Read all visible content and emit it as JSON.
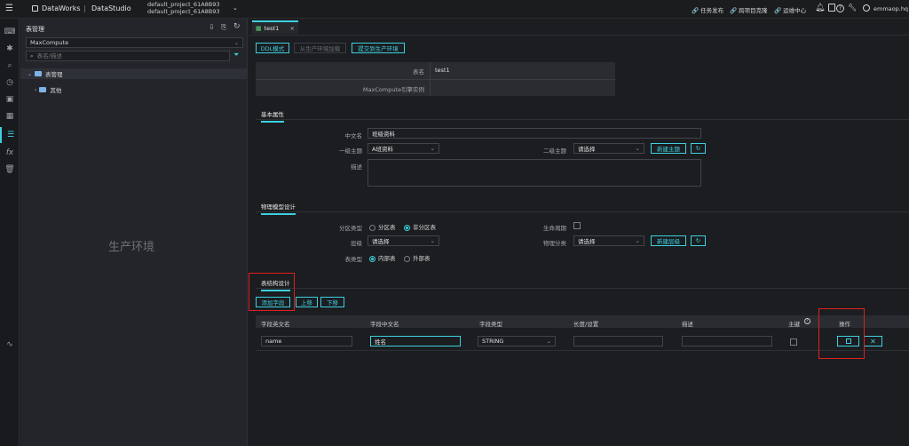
{
  "topbar": {
    "brand": "DataWorks",
    "product": "DataStudio",
    "project_line1": "default_project_61A8B93",
    "project_line2": "default_project_61A8B93",
    "links": [
      "任务发布",
      "跨项目克隆",
      "运维中心"
    ],
    "user": "emmaop.hq"
  },
  "sidepanel": {
    "title": "表管理",
    "engine": "MaxCompute",
    "search_placeholder": "表名/描述",
    "tree": [
      {
        "label": "表管理",
        "expanded": true
      },
      {
        "label": "其他",
        "expanded": false
      }
    ],
    "env_label": "生产环境"
  },
  "tab": {
    "label": "test1"
  },
  "toolbar": {
    "ddl_label": "DDL模式",
    "load_label": "从生产环境加载",
    "submit_label": "提交到生产环境"
  },
  "info": {
    "rows": [
      {
        "label": "表名",
        "value": "test1"
      },
      {
        "label": "MaxCompute引擎实例",
        "value": ""
      }
    ]
  },
  "basic": {
    "section": "基本属性",
    "cn_name_label": "中文名",
    "cn_name_value": "班级资料",
    "topic1_label": "一级主题",
    "topic1_value": "A班资料",
    "topic2_label": "二级主题",
    "topic2_value": "请选择",
    "new_topic_label": "新建主题",
    "desc_label": "描述"
  },
  "physical": {
    "section": "物理模型设计",
    "partition_label": "分区类型",
    "partition_opt1": "分区表",
    "partition_opt2": "非分区表",
    "lifecycle_label": "生命周期",
    "level_label": "层级",
    "level_value": "请选择",
    "physical_class_label": "物理分类",
    "physical_class_value": "请选择",
    "new_level_label": "新建层级",
    "tabletype_label": "表类型",
    "tabletype_opt1": "内部表",
    "tabletype_opt2": "外部表"
  },
  "schema": {
    "section": "表结构设计",
    "add_field": "添加字段",
    "up": "上移",
    "down": "下移",
    "columns": [
      "字段英文名",
      "字段中文名",
      "字段类型",
      "长度/设置",
      "描述",
      "主键",
      "操作"
    ],
    "row": {
      "en_name": "name",
      "cn_name": "姓名",
      "type": "STRING",
      "length": "",
      "desc": ""
    }
  },
  "colors": {
    "accent": "#3dd0e0",
    "highlight": "#e02020",
    "background": "#1b1d20"
  }
}
